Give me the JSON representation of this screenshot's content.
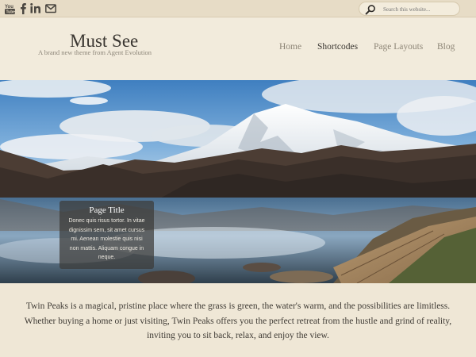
{
  "social": {
    "items": [
      {
        "icon": "youtube-icon",
        "label": "You"
      },
      {
        "icon": "facebook-icon",
        "label": "f"
      },
      {
        "icon": "linkedin-icon",
        "label": "in"
      },
      {
        "icon": "email-icon",
        "label": ""
      }
    ]
  },
  "search": {
    "placeholder": "Search this website..."
  },
  "site": {
    "title": "Must See",
    "tagline": "A brand new theme from Agent Evolution"
  },
  "nav": {
    "items": [
      {
        "label": "Home"
      },
      {
        "label": "Shortcodes"
      },
      {
        "label": "Page Layouts"
      },
      {
        "label": "Blog"
      }
    ],
    "active": "Shortcodes"
  },
  "hero": {
    "caption_title": "Page Title",
    "caption_text": "Donec quis risus tortor. In vitae dignissim sem, sit amet cursus mi. Aenean molestie quis nisi non mattis. Aliquam congue in neque."
  },
  "intro": {
    "line1": "Twin Peaks is a magical, pristine place where the grass is green, the water's warm, and the possibilities are limitless.",
    "line2": "Whether buying a home or just visiting, Twin Peaks offers you the perfect retreat from the hustle and grind of reality,",
    "line3": "inviting you to sit back, relax, and enjoy the view."
  },
  "colors": {
    "page_bg": "#efe7d6",
    "topbar_bg": "#e7dcc6",
    "active_nav": "#3a3631",
    "inactive_nav": "#8d8576"
  }
}
